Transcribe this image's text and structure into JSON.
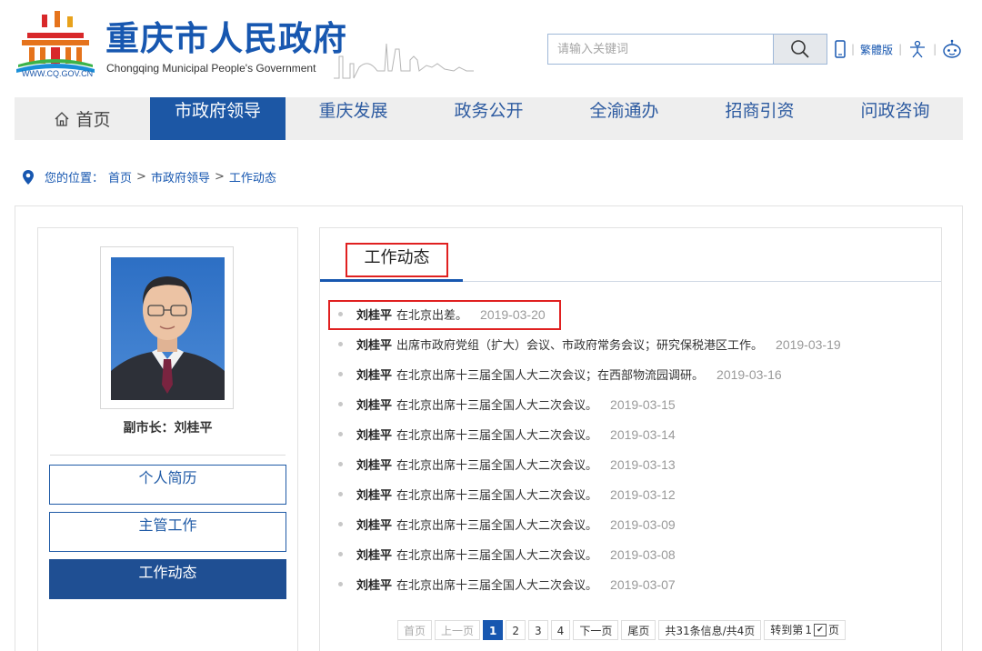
{
  "header": {
    "logo_url_text": "WWW.CQ.GOV.CN",
    "site_title": "重庆市人民政府",
    "site_subtitle": "Chongqing Municipal People's Government",
    "search_placeholder": "请输入关键词",
    "traditional_label": "繁體版",
    "icons": [
      "search-icon",
      "mobile-icon",
      "accessibility-icon",
      "robot-icon"
    ]
  },
  "nav": {
    "items": [
      {
        "label": "首页",
        "icon": "home-icon"
      },
      {
        "label": "市政府领导",
        "active": true
      },
      {
        "label": "重庆发展"
      },
      {
        "label": "政务公开"
      },
      {
        "label": "全渝通办"
      },
      {
        "label": "招商引资"
      },
      {
        "label": "问政咨询"
      }
    ]
  },
  "breadcrumb": {
    "prefix": "您的位置：",
    "items": [
      "首页",
      "市政府领导",
      "工作动态"
    ],
    "separator": ">"
  },
  "profile": {
    "title_name": "副市长：刘桂平",
    "menu": [
      {
        "label": "个人简历"
      },
      {
        "label": "主管工作"
      },
      {
        "label": "工作动态",
        "active": true
      }
    ]
  },
  "section": {
    "title": "工作动态",
    "news": [
      {
        "name": "刘桂平",
        "text": "在北京出差。",
        "date": "2019-03-20"
      },
      {
        "name": "刘桂平",
        "text": "出席市政府党组（扩大）会议、市政府常务会议；研究保税港区工作。",
        "date": "2019-03-19"
      },
      {
        "name": "刘桂平",
        "text": "在北京出席十三届全国人大二次会议；在西部物流园调研。",
        "date": "2019-03-16"
      },
      {
        "name": "刘桂平",
        "text": "在北京出席十三届全国人大二次会议。",
        "date": "2019-03-15"
      },
      {
        "name": "刘桂平",
        "text": "在北京出席十三届全国人大二次会议。",
        "date": "2019-03-14"
      },
      {
        "name": "刘桂平",
        "text": "在北京出席十三届全国人大二次会议。",
        "date": "2019-03-13"
      },
      {
        "name": "刘桂平",
        "text": "在北京出席十三届全国人大二次会议。",
        "date": "2019-03-12"
      },
      {
        "name": "刘桂平",
        "text": "在北京出席十三届全国人大二次会议。",
        "date": "2019-03-09"
      },
      {
        "name": "刘桂平",
        "text": "在北京出席十三届全国人大二次会议。",
        "date": "2019-03-08"
      },
      {
        "name": "刘桂平",
        "text": "在北京出席十三届全国人大二次会议。",
        "date": "2019-03-07"
      }
    ]
  },
  "pager": {
    "first": "首页",
    "prev": "上一页",
    "pages": [
      "1",
      "2",
      "3",
      "4"
    ],
    "current": "1",
    "next": "下一页",
    "last": "尾页",
    "info": "共31条信息/共4页",
    "jump_prefix": "转到第",
    "jump_value": "1",
    "jump_suffix": "页"
  },
  "colors": {
    "brand_blue": "#1757b0",
    "nav_active": "#1c57a5",
    "highlight_red": "#e02020"
  }
}
